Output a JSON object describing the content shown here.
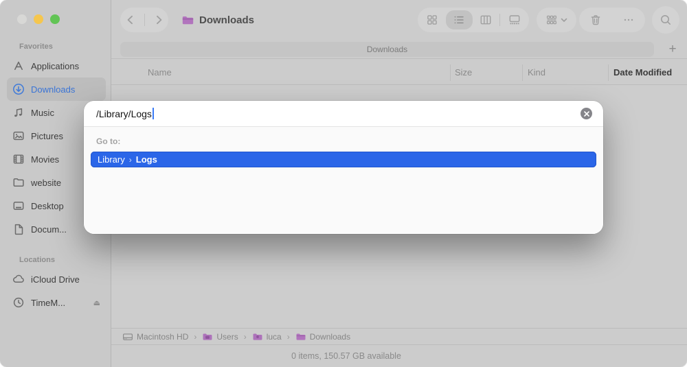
{
  "window": {
    "traffic_lights": {
      "close_color": "#d8d8d6",
      "minimize_color": "#f5c64e",
      "zoom_color": "#62c455"
    }
  },
  "toolbar": {
    "title": "Downloads",
    "view_modes": [
      "icons",
      "list",
      "columns",
      "gallery"
    ],
    "selected_view": "list"
  },
  "tab_bar": {
    "tab_label": "Downloads",
    "new_tab_label": "+"
  },
  "sidebar": {
    "eject_glyph": "⏏",
    "sections": [
      {
        "title": "Favorites",
        "items": [
          {
            "label": "Applications",
            "icon": "app-store-icon"
          },
          {
            "label": "Downloads",
            "icon": "download-circle-icon",
            "selected": true
          },
          {
            "label": "Music",
            "icon": "music-note-icon"
          },
          {
            "label": "Pictures",
            "icon": "photo-icon"
          },
          {
            "label": "Movies",
            "icon": "film-icon"
          },
          {
            "label": "website",
            "icon": "folder-icon"
          },
          {
            "label": "Desktop",
            "icon": "desktop-icon"
          },
          {
            "label": "Docum...",
            "icon": "document-icon"
          }
        ]
      },
      {
        "title": "Locations",
        "items": [
          {
            "label": "iCloud Drive",
            "icon": "cloud-icon"
          },
          {
            "label": "TimeM...",
            "icon": "time-machine-icon",
            "ejectable": true
          }
        ]
      }
    ]
  },
  "list_view": {
    "columns": [
      {
        "label": "Name",
        "sorted": false
      },
      {
        "label": "Size",
        "sorted": false
      },
      {
        "label": "Kind",
        "sorted": false
      },
      {
        "label": "Date Modified",
        "sorted": true
      }
    ]
  },
  "goto_dialog": {
    "input_value": "/Library/Logs",
    "prompt": "Go to:",
    "suggestion": {
      "first": "Library",
      "separator": "›",
      "last": "Logs"
    }
  },
  "path_bar": {
    "separator": "›",
    "items": [
      {
        "label": "Macintosh HD",
        "icon": "hard-drive-icon"
      },
      {
        "label": "Users",
        "icon": "folder-icon"
      },
      {
        "label": "luca",
        "icon": "folder-icon"
      },
      {
        "label": "Downloads",
        "icon": "folder-icon"
      }
    ]
  },
  "status_bar": {
    "text": "0 items, 150.57 GB available"
  },
  "colors": {
    "selection_blue": "#2b66e8",
    "folder_purple": "#b074bd",
    "sidebar_accent_blue": "#3f7ad9",
    "window_gray": "#cccccc"
  }
}
